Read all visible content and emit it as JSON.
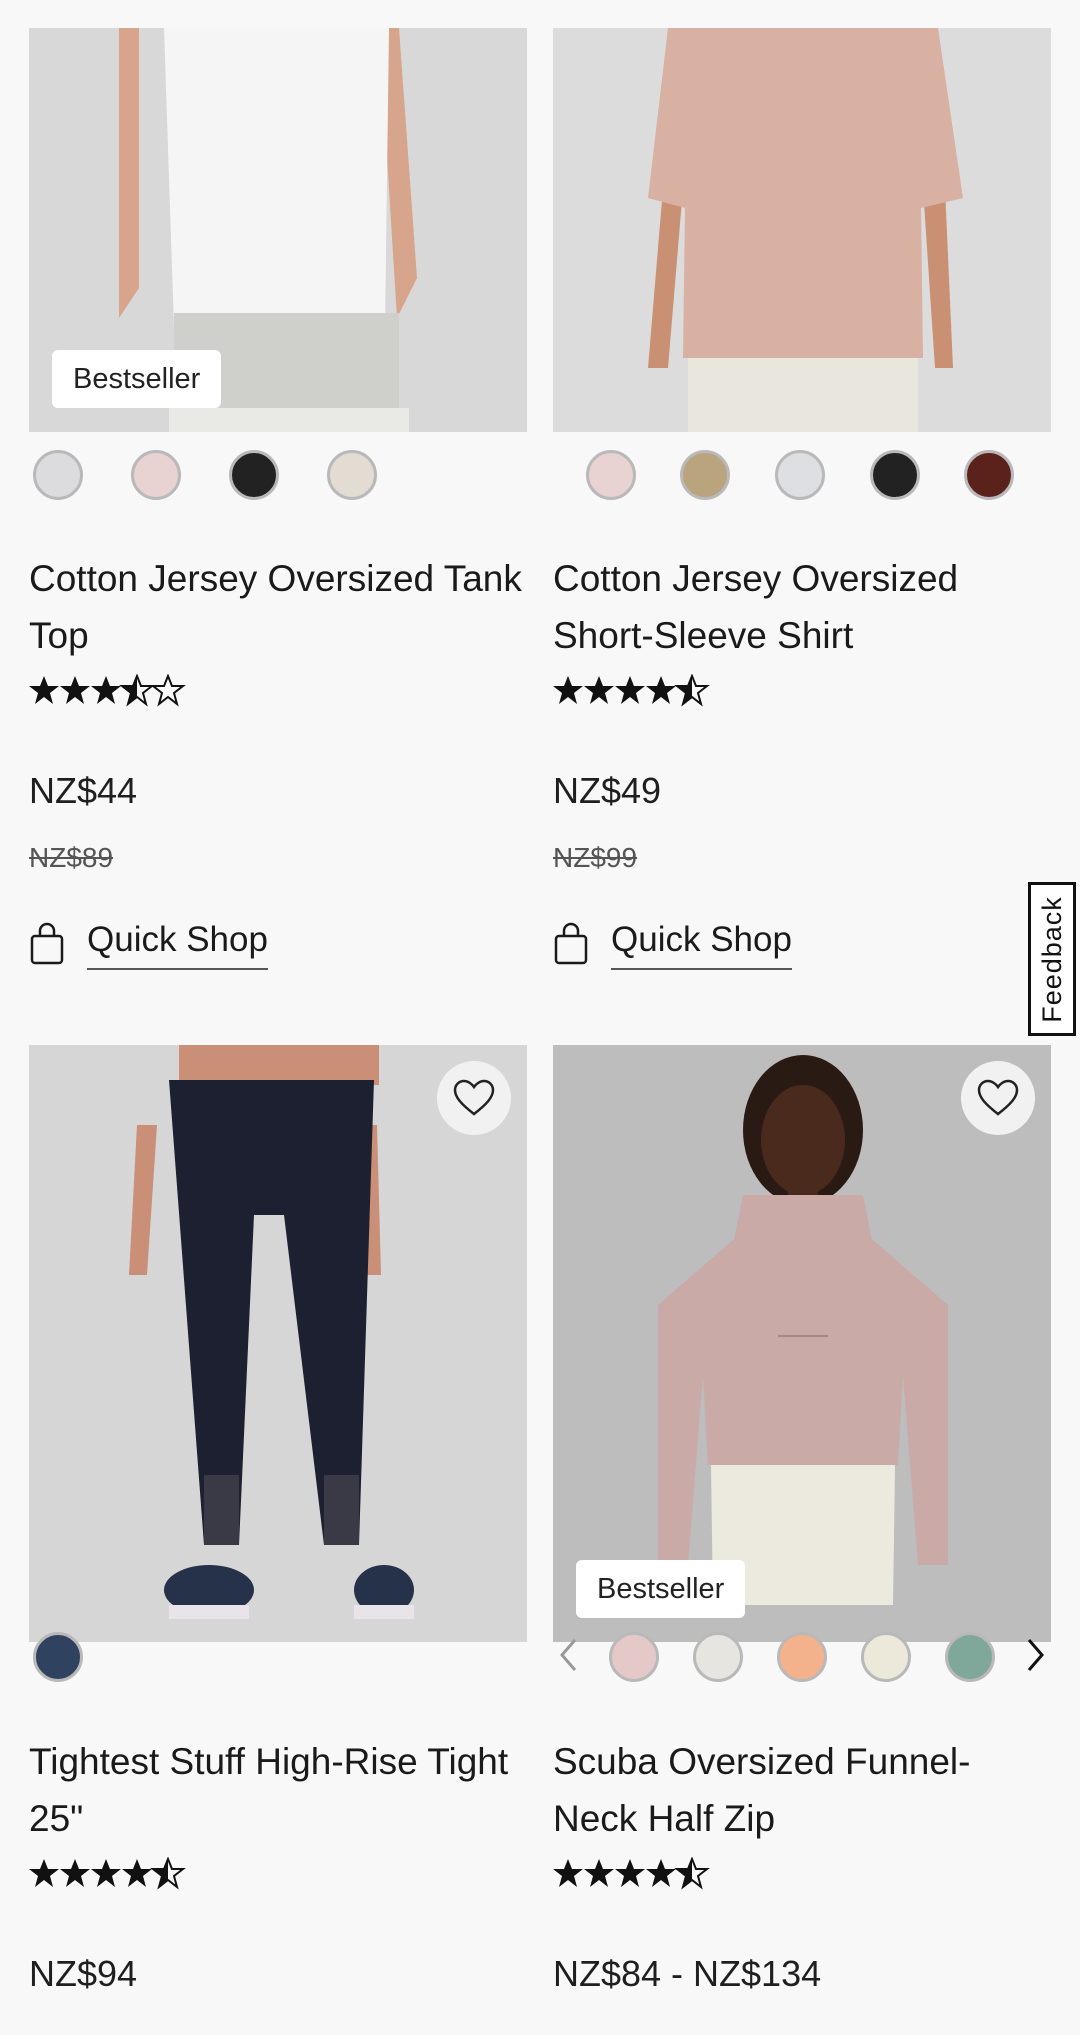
{
  "products": [
    {
      "badge": "Bestseller",
      "swatch_colors": [
        "#dcdcdf",
        "#e8d2d2",
        "#222222",
        "#e2dcd2"
      ],
      "title": "Cotton Jersey Oversized Tank Top",
      "rating": 3.5,
      "price": "NZ$44",
      "original_price": "NZ$89",
      "quick_shop": "Quick Shop",
      "image_bg": "#d8d8d8",
      "image_desc_colors": {
        "garment": "#f4f4f4",
        "bottom": "#cfcfcb",
        "skin": "#d6a58b"
      }
    },
    {
      "swatch_colors": [
        "#e8d2d2",
        "#b9a47e",
        "#dedfe2",
        "#222222",
        "#5a221b"
      ],
      "title": "Cotton Jersey Oversized Short-Sleeve Shirt",
      "rating": 4.5,
      "price": "NZ$49",
      "original_price": "NZ$99",
      "quick_shop": "Quick Shop",
      "image_bg": "#dcdcdc",
      "image_desc_colors": {
        "garment": "#d8b1a2",
        "bottom": "#e8e6dd",
        "skin": "#c99074"
      }
    },
    {
      "swatch_colors": [
        "#2f4260"
      ],
      "title": "Tightest Stuff High-Rise Tight 25\"",
      "rating": 4.5,
      "price": "NZ$94",
      "image_bg": "#d6d6d6",
      "image_desc_colors": {
        "garment": "#1d2030",
        "bottom": "#c98f77",
        "skin": "#c98f77"
      }
    },
    {
      "badge": "Bestseller",
      "swatch_colors": [
        "#e5c9c9",
        "#e6e5df",
        "#f3b28b",
        "#ece8da",
        "#7fa89a"
      ],
      "title": "Scuba Oversized Funnel-Neck Half Zip",
      "rating": 4.5,
      "price": "NZ$84 - NZ$134",
      "image_bg": "#bdbdbd",
      "image_desc_colors": {
        "garment": "#c9aaa7",
        "bottom": "#ece9df",
        "skin": "#4a2a1d"
      }
    }
  ],
  "feedback_label": "Feedback"
}
